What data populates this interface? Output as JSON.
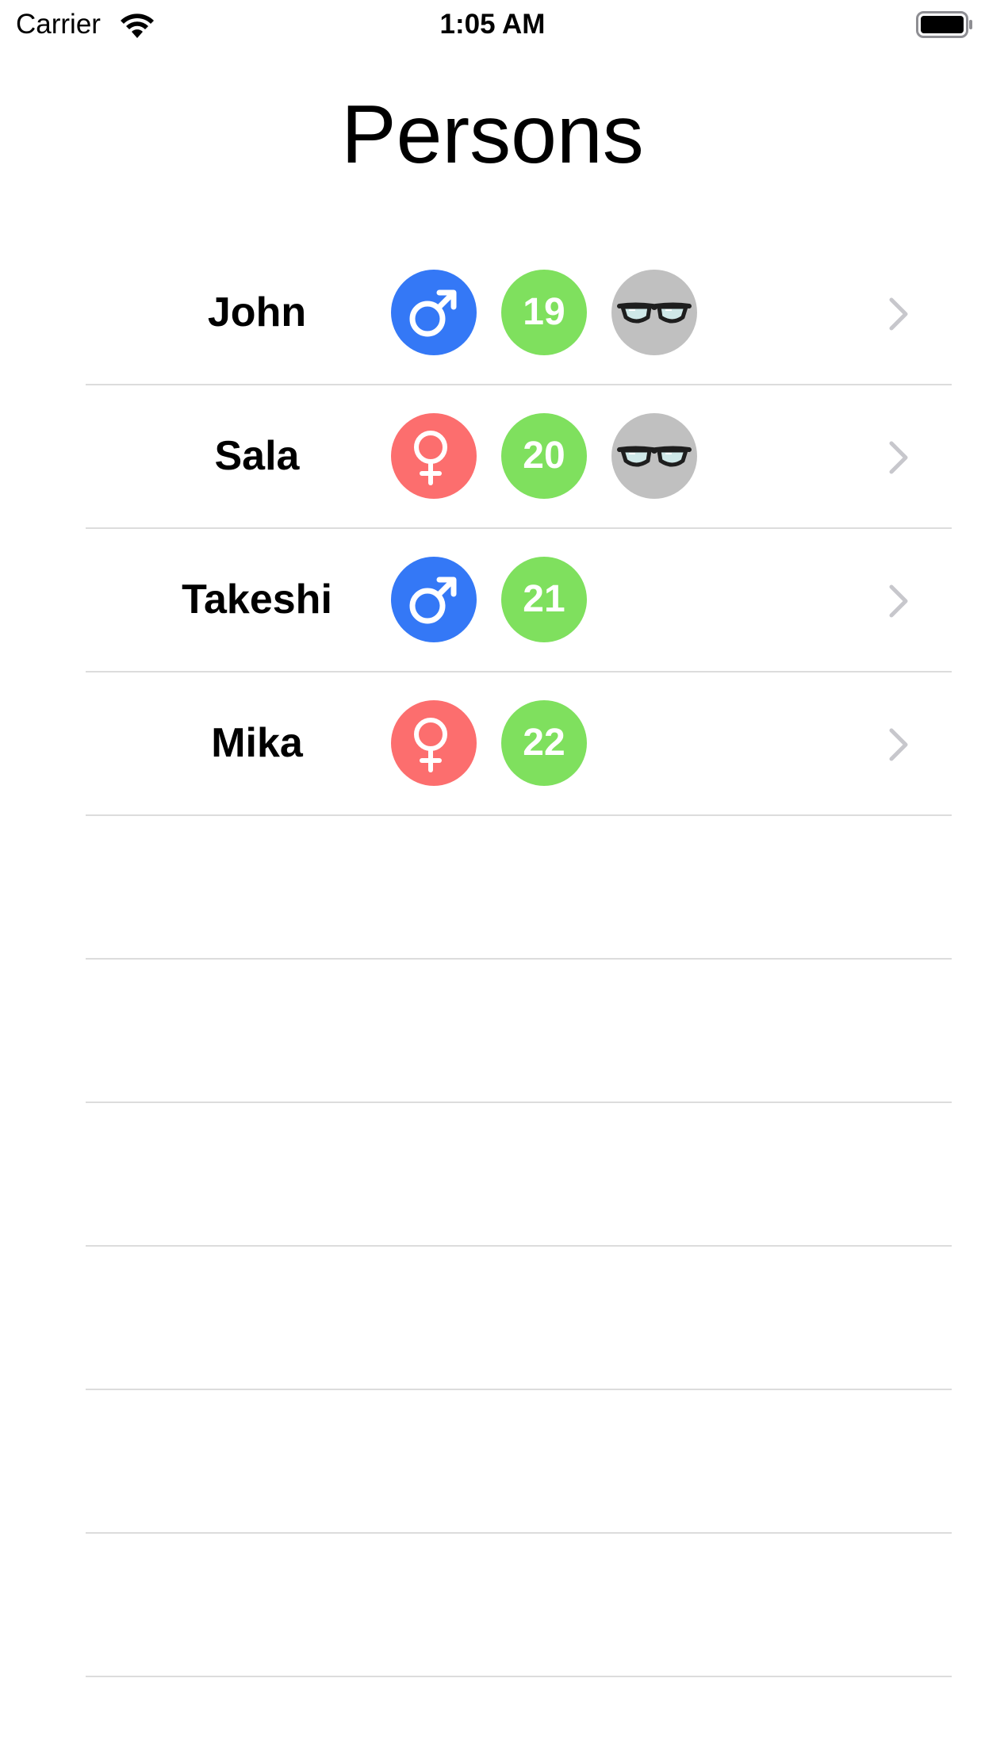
{
  "status_bar": {
    "carrier": "Carrier",
    "time": "1:05 AM",
    "wifi_icon": "wifi-icon",
    "battery_icon": "battery-icon"
  },
  "title": "Persons",
  "colors": {
    "male": "#3478f6",
    "female": "#fc6e6e",
    "age": "#7fe05e",
    "glasses": "#c0c0c0",
    "separator": "#dcdcdc",
    "chevron": "#c7c7cc"
  },
  "persons": [
    {
      "name": "John",
      "gender_icon": "male-icon",
      "age": "19",
      "glasses": true,
      "chevron_icon": "chevron-right-icon"
    },
    {
      "name": "Sala",
      "gender_icon": "female-icon",
      "age": "20",
      "glasses": true,
      "chevron_icon": "chevron-right-icon"
    },
    {
      "name": "Takeshi",
      "gender_icon": "male-icon",
      "age": "21",
      "glasses": false,
      "chevron_icon": "chevron-right-icon"
    },
    {
      "name": "Mika",
      "gender_icon": "female-icon",
      "age": "22",
      "glasses": false,
      "chevron_icon": "chevron-right-icon"
    }
  ],
  "empty_rows": 6
}
